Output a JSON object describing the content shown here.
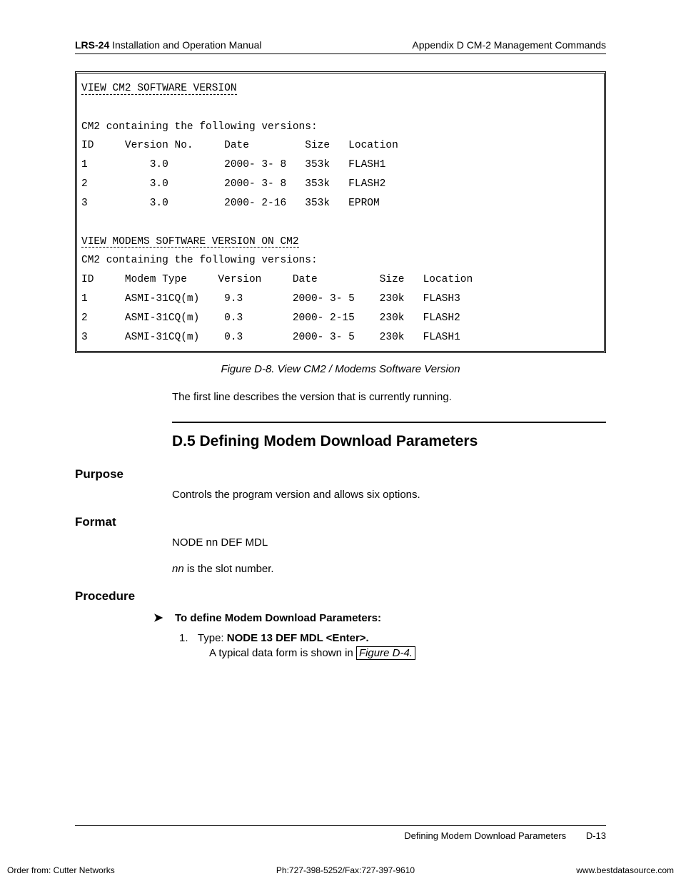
{
  "header": {
    "left_bold": "LRS-24",
    "left_rest": " Installation and Operation Manual",
    "right": "Appendix D  CM-2 Management Commands"
  },
  "terminal": {
    "title1": "VIEW CM2 SOFTWARE VERSION",
    "blank": "",
    "intro1": "CM2 containing the following versions:",
    "hdr1": "ID     Version No.     Date         Size   Location",
    "r1a": "1          3.0         2000- 3- 8   353k   FLASH1",
    "r1b": "2          3.0         2000- 3- 8   353k   FLASH2",
    "r1c": "3          3.0         2000- 2-16   353k   EPROM",
    "title2": "VIEW MODEMS SOFTWARE VERSION ON CM2",
    "intro2": "CM2 containing the following versions:",
    "hdr2": "ID     Modem Type     Version     Date          Size   Location",
    "r2a": "1      ASMI-31CQ(m)    9.3        2000- 3- 5    230k   FLASH3",
    "r2b": "2      ASMI-31CQ(m)    0.3        2000- 2-15    230k   FLASH2",
    "r2c": "3      ASMI-31CQ(m)    0.3        2000- 3- 5    230k   FLASH1"
  },
  "figure_caption": "Figure D-8.  View CM2 / Modems Software Version",
  "body_after_figure": "The first line describes the version that is currently running.",
  "section": {
    "title": "D.5 Defining Modem Download Parameters",
    "purpose_heading": "Purpose",
    "purpose_text": "Controls the program version and allows six options.",
    "format_heading": "Format",
    "format_cmd": "NODE nn DEF MDL",
    "format_note_italic": "nn",
    "format_note_rest": " is the slot number.",
    "procedure_heading": "Procedure",
    "procedure_lead": "To define Modem Download Parameters:",
    "step1_prefix": "1.",
    "step1_type": "Type:  ",
    "step1_cmd": "NODE 13 DEF MDL <Enter>.",
    "step1_sub_pre": "A typical data form is shown in ",
    "step1_figref": "Figure D-4.",
    "arrow": "➤"
  },
  "footer": {
    "label": "Defining Modem Download Parameters",
    "page": "D-13"
  },
  "bottom": {
    "left": "Order from: Cutter Networks",
    "center": "Ph:727-398-5252/Fax:727-397-9610",
    "right": "www.bestdatasource.com"
  }
}
